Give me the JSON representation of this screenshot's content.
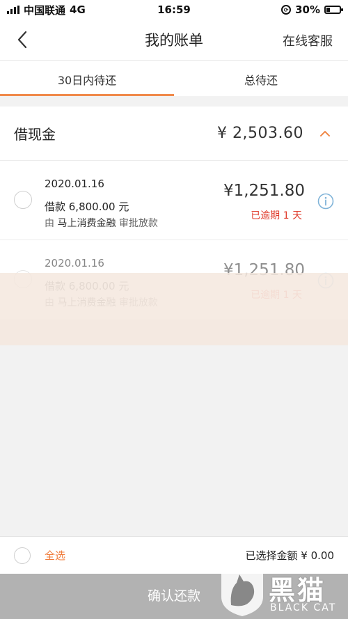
{
  "status_bar": {
    "carrier": "中国联通",
    "network": "4G",
    "time": "16:59",
    "battery": "30%",
    "battery_level": 0.3
  },
  "nav": {
    "title": "我的账单",
    "right_label": "在线客服"
  },
  "tabs": [
    {
      "label": "30日内待还",
      "active": true
    },
    {
      "label": "总待还",
      "active": false
    }
  ],
  "section": {
    "title": "借现金",
    "total": "¥ 2,503.60"
  },
  "loans": [
    {
      "date": "2020.01.16",
      "principal": "借款 6,800.00 元",
      "lender_prefix": "由",
      "lender": "马上消费金融",
      "lender_suffix": "审批放款",
      "amount": "¥1,251.80",
      "status": "已逾期 1 天"
    },
    {
      "date": "2020.01.16",
      "principal": "借款 6,800.00 元",
      "lender_prefix": "由",
      "lender": "马上消费金融",
      "lender_suffix": "审批放款",
      "amount": "¥1,251.80",
      "status": "已逾期 1 天"
    }
  ],
  "footer": {
    "select_all": "全选",
    "selected_amount": "已选择金额 ¥ 0.00",
    "confirm": "确认还款"
  },
  "logo": {
    "cn": "黑猫",
    "en": "BLACK CAT"
  },
  "colors": {
    "accent": "#f08a4b",
    "overdue": "#e03c2c",
    "disabled_button": "#b2b2b2"
  }
}
